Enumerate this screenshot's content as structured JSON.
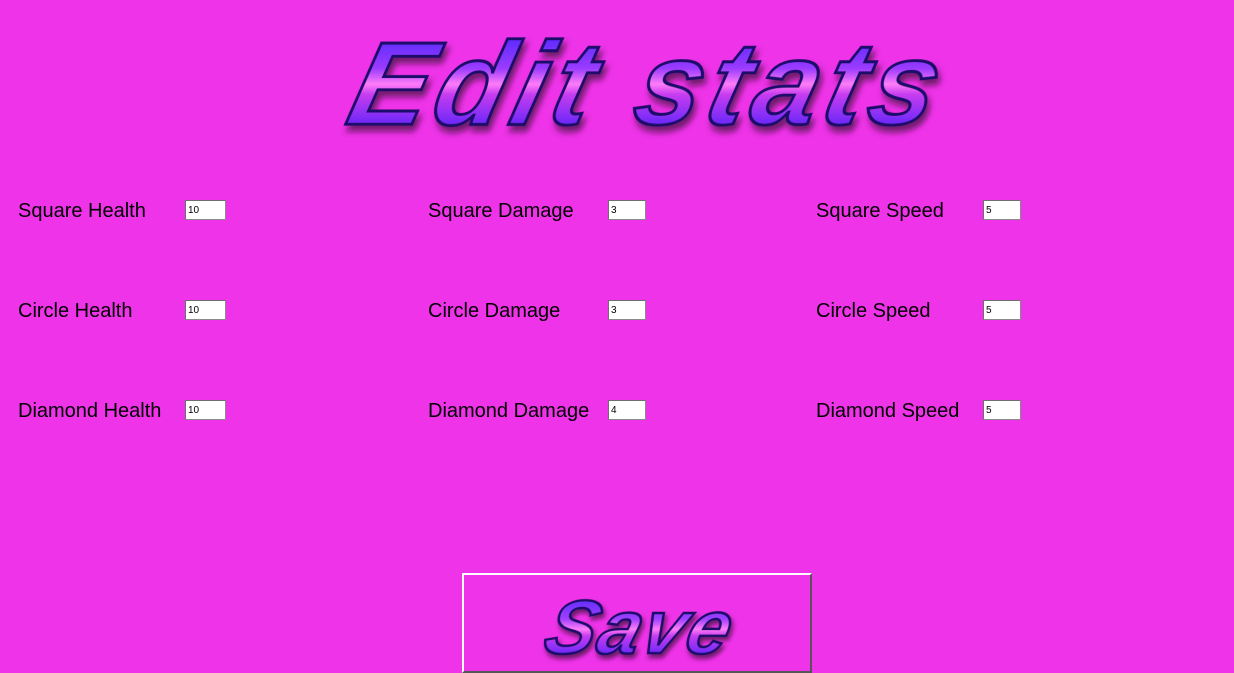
{
  "page": {
    "title": "Edit stats",
    "background_color": "#ee33e8"
  },
  "stats": {
    "square_health": {
      "label": "Square Health",
      "value": "10"
    },
    "square_damage": {
      "label": "Square Damage",
      "value": "3"
    },
    "square_speed": {
      "label": "Square Speed",
      "value": "5"
    },
    "circle_health": {
      "label": "Circle Health",
      "value": "10"
    },
    "circle_damage": {
      "label": "Circle Damage",
      "value": "3"
    },
    "circle_speed": {
      "label": "Circle Speed",
      "value": "5"
    },
    "diamond_health": {
      "label": "Diamond Health",
      "value": "10"
    },
    "diamond_damage": {
      "label": "Diamond Damage",
      "value": "4"
    },
    "diamond_speed": {
      "label": "Diamond Speed",
      "value": "5"
    }
  },
  "save_button": {
    "label": "Save"
  },
  "logo_colors": {
    "gradient_top": "#2a1bff",
    "gradient_mid": "#ff6ef6",
    "gradient_bottom": "#2a1bff",
    "shadow": "#3a0a4a"
  }
}
